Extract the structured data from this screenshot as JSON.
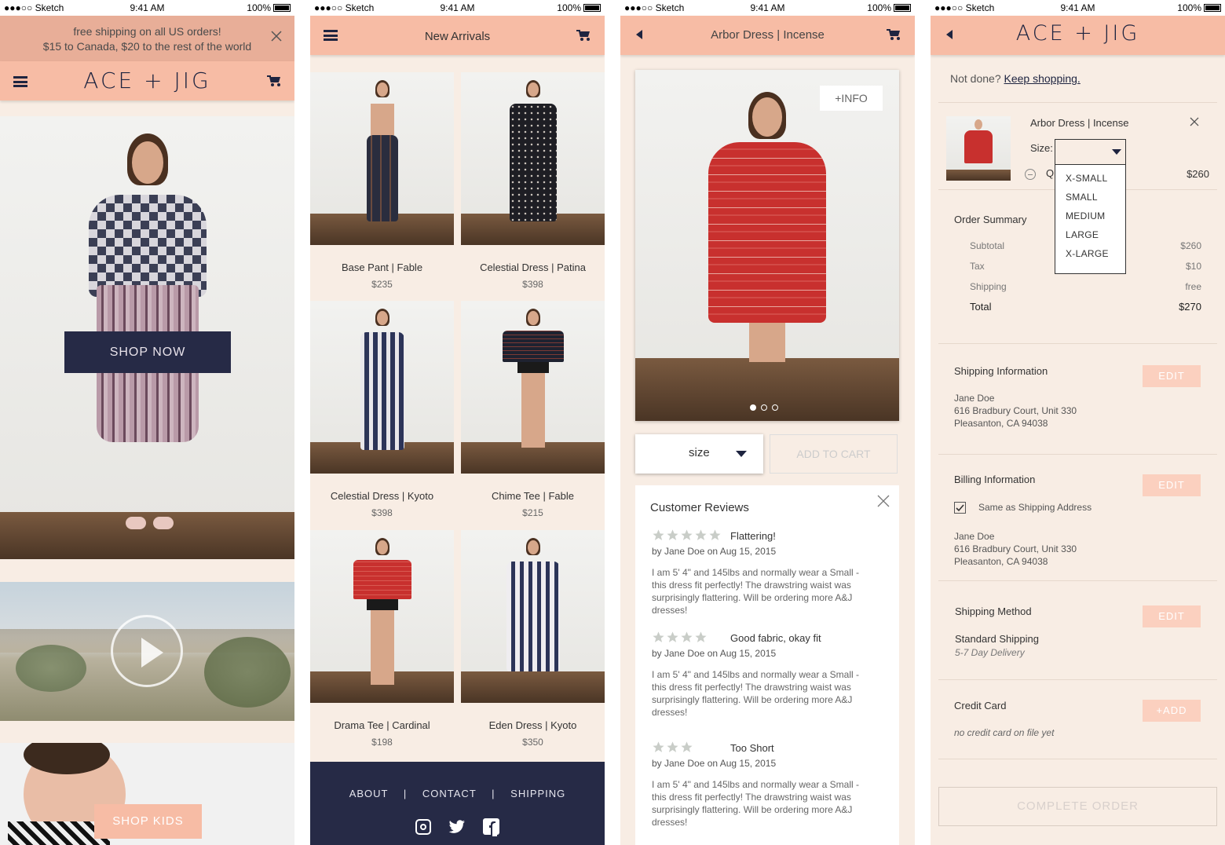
{
  "status": {
    "carrier": "●●●○○ Sketch",
    "time": "9:41 AM",
    "battery": "100%"
  },
  "home": {
    "banner_line1": "free shipping on all US orders!",
    "banner_line2": "$15 to Canada, $20 to the rest of the world",
    "logo": "ACE + JIG",
    "shop_now": "SHOP NOW",
    "shop_kids": "SHOP KIDS"
  },
  "arrivals": {
    "title": "New Arrivals",
    "products": [
      {
        "name": "Base Pant | Fable",
        "price": "$235"
      },
      {
        "name": "Celestial Dress | Patina",
        "price": "$398"
      },
      {
        "name": "Celestial Dress | Kyoto",
        "price": "$398"
      },
      {
        "name": "Chime Tee | Fable",
        "price": "$215"
      },
      {
        "name": "Drama Tee | Cardinal",
        "price": "$198"
      },
      {
        "name": "Eden Dress | Kyoto",
        "price": "$350"
      }
    ],
    "footer_links": [
      "ABOUT",
      "CONTACT",
      "SHIPPING"
    ],
    "footer_sep": "|"
  },
  "product": {
    "title": "Arbor Dress | Incense",
    "info_button": "+INFO",
    "size_label": "size",
    "add_to_cart": "ADD TO CART",
    "reviews_title": "Customer Reviews",
    "reviews": [
      {
        "rating": 5,
        "title": "Flattering!",
        "byline": "by Jane Doe on Aug 15, 2015",
        "body": "I am 5' 4\" and 145lbs and normally wear a Small - this dress fit perfectly! The drawstring waist was surprisingly flattering. Will be ordering more A&J dresses!"
      },
      {
        "rating": 4,
        "title": "Good fabric, okay fit",
        "byline": "by Jane Doe on Aug 15, 2015",
        "body": "I am 5' 4\" and 145lbs and normally wear a Small - this dress fit perfectly! The drawstring waist was surprisingly flattering. Will be ordering more A&J dresses!"
      },
      {
        "rating": 3,
        "title": "Too Short",
        "byline": "by Jane Doe on Aug 15, 2015",
        "body": "I am 5' 4\" and 145lbs and normally wear a Small - this dress fit perfectly! The drawstring waist was surprisingly flattering. Will be ordering more A&J dresses!"
      }
    ]
  },
  "checkout": {
    "logo": "ACE + JIG",
    "not_done": "Not done?",
    "keep_shopping": "Keep shopping.",
    "item_name": "Arbor Dress | Incense",
    "size_label": "Size:",
    "qty_label": "Q",
    "item_price": "$260",
    "size_options": [
      "X-SMALL",
      "SMALL",
      "MEDIUM",
      "LARGE",
      "X-LARGE"
    ],
    "order_summary": "Order Summary",
    "summary_rows": [
      {
        "label": "Subtotal",
        "value": "$260"
      },
      {
        "label": "Tax",
        "value": "$10"
      },
      {
        "label": "Shipping",
        "value": "free"
      }
    ],
    "total_label": "Total",
    "total_value": "$270",
    "shipping_info_title": "Shipping Information",
    "billing_info_title": "Billing Information",
    "edit": "EDIT",
    "same_as_shipping": "Same as Shipping Address",
    "address": {
      "name": "Jane Doe",
      "street": "616 Bradbury Court, Unit 330",
      "city": "Pleasanton, CA 94038"
    },
    "shipping_method_title": "Shipping Method",
    "shipping_method_name": "Standard Shipping",
    "shipping_method_time": "5-7 Day Delivery",
    "credit_card_title": "Credit Card",
    "add_card": "+ADD",
    "no_card": "no credit card on file yet",
    "complete_order": "COMPLETE ORDER"
  },
  "colors": {
    "peach": "#f7bca5",
    "navy": "#262a46",
    "cream": "#f8ede4",
    "red_dress": "#c8302e"
  }
}
